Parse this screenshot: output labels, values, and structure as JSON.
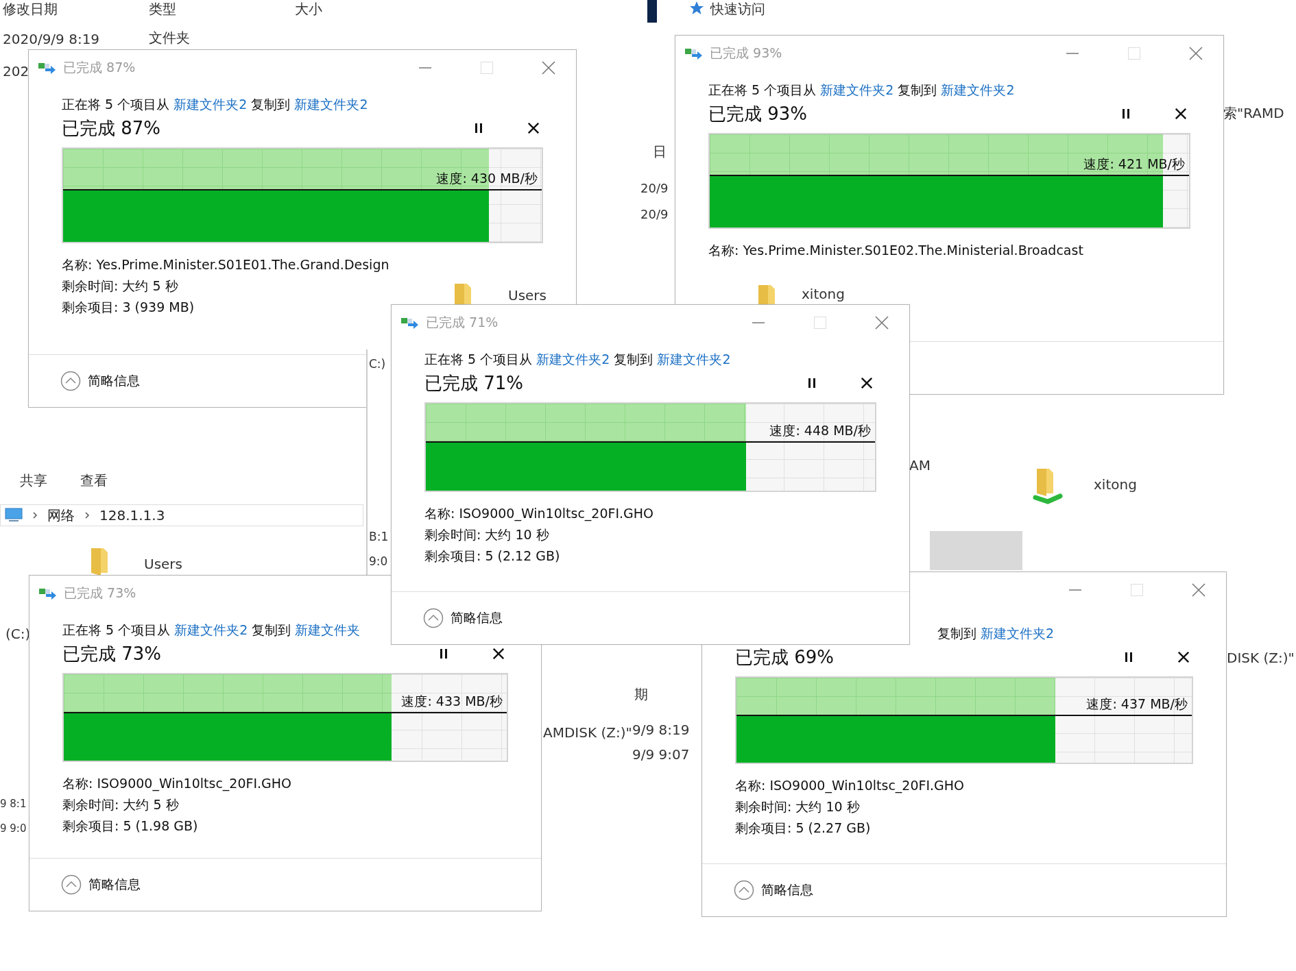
{
  "explorer": {
    "fragments": [
      {
        "kind": "text",
        "text": "修改日期"
      },
      {
        "kind": "text",
        "text": "类型"
      },
      {
        "kind": "text",
        "text": "大小"
      },
      {
        "kind": "text",
        "text": "2020/9/9 8:19"
      },
      {
        "kind": "text",
        "text": "文件夹"
      },
      {
        "kind": "text",
        "text": "202"
      },
      {
        "kind": "nav",
        "text": "快速访问"
      },
      {
        "kind": "text",
        "text": "索\"RAMD"
      },
      {
        "kind": "text",
        "text": "日"
      },
      {
        "kind": "text",
        "text": "20/9"
      },
      {
        "kind": "text",
        "text": "20/9"
      },
      {
        "kind": "folder",
        "text": "Users"
      },
      {
        "kind": "tab",
        "text": "共享"
      },
      {
        "kind": "tab",
        "text": "查看"
      },
      {
        "kind": "folder",
        "text": "Users"
      },
      {
        "kind": "text",
        "text": "C:)"
      },
      {
        "kind": "text",
        "text": "B:1"
      },
      {
        "kind": "text",
        "text": "9:0"
      },
      {
        "kind": "text",
        "text": "AM"
      },
      {
        "kind": "shared",
        "text": "xitong"
      },
      {
        "kind": "text",
        "text": "DISK (Z:)\""
      },
      {
        "kind": "text",
        "text": "期"
      },
      {
        "kind": "text",
        "text": "AMDISK (Z:)\""
      },
      {
        "kind": "text",
        "text": "9/9 8:19"
      },
      {
        "kind": "text",
        "text": "9/9 9:07"
      },
      {
        "kind": "text",
        "text": "(C:)"
      },
      {
        "kind": "text",
        "text": "9 8:1"
      },
      {
        "kind": "text",
        "text": "9 9:0"
      },
      {
        "kind": "folder",
        "text": "xitong"
      }
    ],
    "breadcrumb": [
      "网络",
      "128.1.1.3"
    ]
  },
  "dialogs": [
    {
      "title": "已完成 87%",
      "description": [
        {
          "text": "正在将 5 个项目从 ",
          "link": false
        },
        {
          "text": "新建文件夹2",
          "link": true
        },
        {
          "text": " 复制到 ",
          "link": false
        },
        {
          "text": "新建文件夹2",
          "link": true
        }
      ],
      "heading": "已完成 87%",
      "level": 0.89,
      "speed": "速度: 430 MB/秒",
      "details": [
        "名称: Yes.Prime.Minister.S01E01.The.Grand.Design",
        "剩余时间: 大约 5 秒",
        "剩余项目: 3 (939 MB)"
      ],
      "footer": "简略信息"
    },
    {
      "title": "已完成 93%",
      "description": [
        {
          "text": "正在将 5 个项目从 ",
          "link": false
        },
        {
          "text": "新建文件夹2",
          "link": true
        },
        {
          "text": " 复制到 ",
          "link": false
        },
        {
          "text": "新建文件夹2",
          "link": true
        }
      ],
      "heading": "已完成 93%",
      "level": 0.945,
      "speed": "速度: 421 MB/秒",
      "details": [
        "名称: Yes.Prime.Minister.S01E02.The.Ministerial.Broadcast"
      ]
    },
    {
      "title": "已完成 73%",
      "description": [
        {
          "text": "正在将 5 个项目从 ",
          "link": false
        },
        {
          "text": "新建文件夹2",
          "link": true
        },
        {
          "text": " 复制到 ",
          "link": false
        },
        {
          "text": "新建文件夹",
          "link": true
        }
      ],
      "heading": "已完成 73%",
      "level": 0.74,
      "speed": "速度: 433 MB/秒",
      "details": [
        "名称: ISO9000_Win10ltsc_20FI.GHO",
        "剩余时间: 大约 5 秒",
        "剩余项目: 5 (1.98 GB)"
      ],
      "footer": "简略信息"
    },
    {
      "description": [
        {
          "text": "复制到 ",
          "link": false
        },
        {
          "text": "新建文件夹2",
          "link": true
        }
      ],
      "heading": "已完成 69%",
      "level": 0.7,
      "speed": "速度: 437 MB/秒",
      "details": [
        "名称: ISO9000_Win10ltsc_20FI.GHO",
        "剩余时间: 大约 10 秒",
        "剩余项目: 5 (2.27 GB)"
      ],
      "footer": "简略信息"
    },
    {
      "title": "已完成 71%",
      "description": [
        {
          "text": "正在将 5 个项目从 ",
          "link": false
        },
        {
          "text": "新建文件夹2",
          "link": true
        },
        {
          "text": " 复制到 ",
          "link": false
        },
        {
          "text": "新建文件夹2",
          "link": true
        }
      ],
      "heading": "已完成 71%",
      "level": 0.713,
      "speed": "速度: 448 MB/秒",
      "details": [
        "名称: ISO9000_Win10ltsc_20FI.GHO",
        "剩余时间: 大约 10 秒",
        "剩余项目: 5 (2.12 GB)"
      ],
      "footer": "简略信息"
    }
  ]
}
